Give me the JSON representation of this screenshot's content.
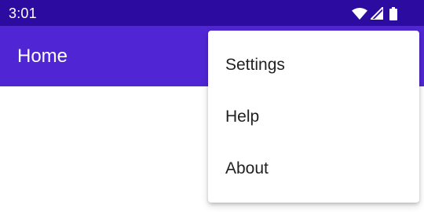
{
  "status_bar": {
    "time": "3:01",
    "background": "#2c0ca0",
    "icons": [
      "wifi-icon",
      "signal-icon",
      "battery-icon"
    ]
  },
  "app_bar": {
    "title": "Home",
    "background": "#5026d4"
  },
  "overflow_menu": {
    "items": [
      {
        "label": "Settings"
      },
      {
        "label": "Help"
      },
      {
        "label": "About"
      }
    ]
  }
}
